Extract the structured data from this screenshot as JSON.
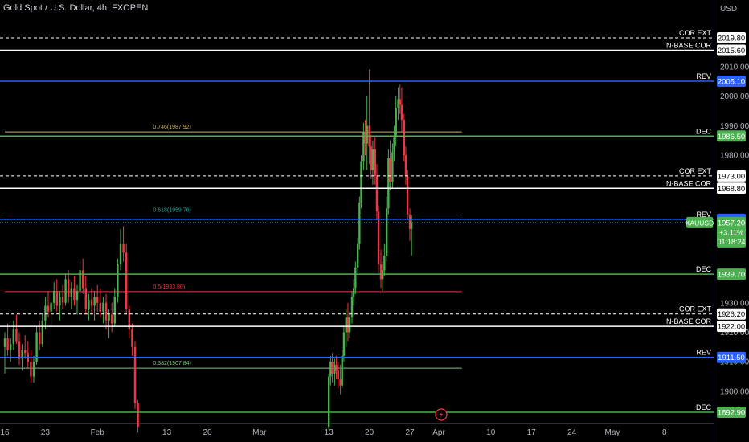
{
  "header": {
    "title": "Gold Spot / U.S. Dollar, 4h, FXOPEN"
  },
  "axis": {
    "currency": "USD"
  },
  "chart_data": {
    "type": "candlestick",
    "title": "Gold Spot / U.S. Dollar, 4h, FXOPEN",
    "symbol": "XAUUSD",
    "ylim": [
      1890,
      2025
    ],
    "y_ticks": [
      1900.0,
      1910.0,
      1920.0,
      1930.0,
      1980.0,
      1990.0,
      2000.0,
      2010.0
    ],
    "x_ticks": [
      {
        "label": "16",
        "x": 0
      },
      {
        "label": "23",
        "x": 7
      },
      {
        "label": "Feb",
        "x": 16
      },
      {
        "label": "13",
        "x": 28
      },
      {
        "label": "20",
        "x": 35
      },
      {
        "label": "Mar",
        "x": 44
      },
      {
        "label": "13",
        "x": 56
      },
      {
        "label": "20",
        "x": 63
      },
      {
        "label": "27",
        "x": 70
      },
      {
        "label": "Apr",
        "x": 75
      },
      {
        "label": "10",
        "x": 84
      },
      {
        "label": "17",
        "x": 91
      },
      {
        "label": "24",
        "x": 98
      },
      {
        "label": "May",
        "x": 105
      },
      {
        "label": "8",
        "x": 114
      }
    ],
    "levels": [
      {
        "value": 2019.8,
        "name": "COR EXT",
        "style": "dashed",
        "color": "#ffffff",
        "pill_bg": "#ffffff",
        "pill_fg": "#000000",
        "x_start": 0
      },
      {
        "value": 2015.6,
        "name": "N-BASE COR",
        "style": "solid",
        "color": "#ffffff",
        "pill_bg": "#ffffff",
        "pill_fg": "#000000",
        "x_start": 0
      },
      {
        "value": 2005.1,
        "name": "REV",
        "style": "solid",
        "color": "#2962ff",
        "pill_bg": "#2962ff",
        "pill_fg": "#ffffff",
        "x_start": 0
      },
      {
        "value": 1986.5,
        "name": "DEC",
        "style": "solid",
        "color": "#4caf50",
        "pill_bg": "#4caf50",
        "pill_fg": "#ffffff",
        "x_start": 0
      },
      {
        "value": 1973.0,
        "name": "COR EXT",
        "style": "dashed",
        "color": "#ffffff",
        "pill_bg": "#ffffff",
        "pill_fg": "#000000",
        "x_start": 0
      },
      {
        "value": 1968.8,
        "name": "N-BASE COR",
        "style": "solid",
        "color": "#ffffff",
        "pill_bg": "#ffffff",
        "pill_fg": "#000000",
        "x_start": 0
      },
      {
        "value": 1958.3,
        "name": "REV",
        "style": "solid",
        "color": "#2962ff",
        "pill_bg": "#2962ff",
        "pill_fg": "#ffffff",
        "x_start": 0
      },
      {
        "value": 1939.7,
        "name": "DEC",
        "style": "solid",
        "color": "#4caf50",
        "pill_bg": "#4caf50",
        "pill_fg": "#ffffff",
        "x_start": 0
      },
      {
        "value": 1926.2,
        "name": "COR EXT",
        "style": "dashed",
        "color": "#ffffff",
        "pill_bg": "#ffffff",
        "pill_fg": "#000000",
        "x_start": 0
      },
      {
        "value": 1922.0,
        "name": "N-BASE COR",
        "style": "solid",
        "color": "#ffffff",
        "pill_bg": "#ffffff",
        "pill_fg": "#000000",
        "x_start": 0
      },
      {
        "value": 1911.5,
        "name": "REV",
        "style": "solid",
        "color": "#2962ff",
        "pill_bg": "#2962ff",
        "pill_fg": "#ffffff",
        "x_start": 0
      },
      {
        "value": 1892.9,
        "name": "DEC",
        "style": "solid",
        "color": "#4caf50",
        "pill_bg": "#4caf50",
        "pill_fg": "#ffffff",
        "x_start": 0
      }
    ],
    "fib_levels": [
      {
        "value": 1987.92,
        "label": "0.746(1987.92)",
        "color": "#c8b46a"
      },
      {
        "value": 1959.76,
        "label": "0.618(1959.76)",
        "color": "#26a69a"
      },
      {
        "value": 1933.8,
        "label": "0.5(1933.80)",
        "color": "#f23645"
      },
      {
        "value": 1907.84,
        "label": "0.382(1907.84)",
        "color": "#81c784"
      }
    ],
    "fib_extent": {
      "x_from": 0,
      "x_to": 79
    },
    "current_price": {
      "symbol": "XAUUSD",
      "value": 1957.2,
      "price_label": "1957.20",
      "change": "+3.11%",
      "countdown": "01:18:24",
      "color": "#4caf50"
    },
    "series": [
      {
        "name": "",
        "candles": [
          [
            0,
            1915,
            1920,
            1906,
            1918
          ],
          [
            0.5,
            1918,
            1923,
            1912,
            1914
          ],
          [
            1,
            1914,
            1918,
            1910,
            1916
          ],
          [
            1.5,
            1916,
            1924,
            1914,
            1921
          ],
          [
            2,
            1921,
            1926,
            1916,
            1917
          ],
          [
            2.5,
            1917,
            1920,
            1909,
            1911
          ],
          [
            3,
            1911,
            1916,
            1907,
            1914
          ],
          [
            3.5,
            1914,
            1919,
            1911,
            1913
          ],
          [
            4,
            1913,
            1917,
            1908,
            1910
          ],
          [
            4.5,
            1910,
            1914,
            1903,
            1905
          ],
          [
            5,
            1905,
            1912,
            1903,
            1910
          ],
          [
            5.5,
            1910,
            1922,
            1909,
            1920
          ],
          [
            6,
            1920,
            1924,
            1914,
            1916
          ],
          [
            6.5,
            1916,
            1926,
            1915,
            1924
          ],
          [
            7,
            1924,
            1932,
            1921,
            1929
          ],
          [
            7.5,
            1929,
            1934,
            1925,
            1927
          ],
          [
            8,
            1927,
            1931,
            1922,
            1930
          ],
          [
            8.5,
            1930,
            1937,
            1928,
            1934
          ],
          [
            9,
            1934,
            1938,
            1927,
            1929
          ],
          [
            9.5,
            1929,
            1934,
            1924,
            1932
          ],
          [
            10,
            1932,
            1936,
            1928,
            1930
          ],
          [
            10.5,
            1930,
            1940,
            1929,
            1938
          ],
          [
            11,
            1938,
            1941,
            1930,
            1932
          ],
          [
            11.5,
            1932,
            1937,
            1928,
            1935
          ],
          [
            12,
            1935,
            1939,
            1929,
            1931
          ],
          [
            12.5,
            1931,
            1936,
            1926,
            1934
          ],
          [
            13,
            1934,
            1944,
            1933,
            1941
          ],
          [
            13.5,
            1941,
            1945,
            1933,
            1935
          ],
          [
            14,
            1935,
            1939,
            1926,
            1928
          ],
          [
            14.5,
            1928,
            1933,
            1924,
            1931
          ],
          [
            15,
            1931,
            1935,
            1926,
            1929
          ],
          [
            15.5,
            1929,
            1934,
            1924,
            1932
          ],
          [
            16,
            1932,
            1936,
            1927,
            1930
          ],
          [
            16.5,
            1930,
            1935,
            1925,
            1927
          ],
          [
            17,
            1927,
            1932,
            1923,
            1930
          ],
          [
            17.5,
            1930,
            1933,
            1921,
            1924
          ],
          [
            18,
            1924,
            1928,
            1918,
            1926
          ],
          [
            18.5,
            1926,
            1930,
            1920,
            1923
          ],
          [
            19,
            1923,
            1935,
            1922,
            1932
          ],
          [
            19.5,
            1932,
            1945,
            1930,
            1943
          ],
          [
            20,
            1943,
            1955,
            1941,
            1950
          ],
          [
            20.5,
            1950,
            1956,
            1944,
            1947
          ],
          [
            21,
            1947,
            1950,
            1926,
            1928
          ],
          [
            21.5,
            1928,
            1929,
            1918,
            1921
          ],
          [
            22,
            1921,
            1923,
            1912,
            1915
          ],
          [
            22.5,
            1915,
            1917,
            1894,
            1896
          ],
          [
            23,
            1896,
            1897,
            1886,
            1888
          ],
          [
            56,
            1888,
            1906,
            1887,
            1905
          ],
          [
            56.3,
            1905,
            1912,
            1902,
            1910
          ],
          [
            56.6,
            1910,
            1913,
            1903,
            1906
          ],
          [
            57,
            1906,
            1911,
            1902,
            1909
          ],
          [
            57.3,
            1909,
            1912,
            1904,
            1907
          ],
          [
            57.6,
            1907,
            1910,
            1901,
            1904
          ],
          [
            58,
            1904,
            1909,
            1899,
            1902
          ],
          [
            58.3,
            1902,
            1914,
            1901,
            1912
          ],
          [
            58.6,
            1912,
            1922,
            1910,
            1920
          ],
          [
            59,
            1920,
            1928,
            1915,
            1925
          ],
          [
            59.3,
            1925,
            1930,
            1917,
            1920
          ],
          [
            59.6,
            1920,
            1927,
            1918,
            1925
          ],
          [
            60,
            1925,
            1934,
            1923,
            1932
          ],
          [
            60.3,
            1932,
            1938,
            1929,
            1935
          ],
          [
            60.6,
            1935,
            1944,
            1933,
            1942
          ],
          [
            61,
            1942,
            1952,
            1940,
            1950
          ],
          [
            61.3,
            1950,
            1966,
            1948,
            1964
          ],
          [
            61.6,
            1964,
            1980,
            1962,
            1978
          ],
          [
            62,
            1978,
            1991,
            1975,
            1988
          ],
          [
            62.3,
            1988,
            1992,
            1980,
            1984
          ],
          [
            62.6,
            1984,
            2000,
            1975,
            1990
          ],
          [
            63,
            1990,
            2009,
            1977,
            1983
          ],
          [
            63.3,
            1983,
            1987,
            1972,
            1975
          ],
          [
            63.6,
            1975,
            1985,
            1970,
            1982
          ],
          [
            64,
            1982,
            1986,
            1970,
            1973
          ],
          [
            64.3,
            1973,
            1977,
            1958,
            1961
          ],
          [
            64.6,
            1961,
            1963,
            1940,
            1943
          ],
          [
            65,
            1943,
            1948,
            1935,
            1938
          ],
          [
            65.3,
            1938,
            1944,
            1934,
            1941
          ],
          [
            65.6,
            1941,
            1950,
            1939,
            1946
          ],
          [
            66,
            1946,
            1966,
            1944,
            1962
          ],
          [
            66.3,
            1962,
            1982,
            1960,
            1979
          ],
          [
            66.6,
            1979,
            1985,
            1968,
            1971
          ],
          [
            67,
            1971,
            1984,
            1969,
            1981
          ],
          [
            67.3,
            1981,
            1990,
            1978,
            1986
          ],
          [
            67.6,
            1986,
            2000,
            1983,
            1996
          ],
          [
            68,
            1996,
            2003,
            1992,
            1999
          ],
          [
            68.3,
            1999,
            2004,
            1994,
            1997
          ],
          [
            68.6,
            1997,
            2003,
            1988,
            1992
          ],
          [
            69,
            1992,
            1994,
            1978,
            1980
          ],
          [
            69.3,
            1980,
            1983,
            1970,
            1973
          ],
          [
            69.6,
            1973,
            1975,
            1958,
            1960
          ],
          [
            70,
            1960,
            1962,
            1951,
            1955
          ],
          [
            70.3,
            1955,
            1960,
            1946,
            1957
          ]
        ]
      }
    ]
  }
}
